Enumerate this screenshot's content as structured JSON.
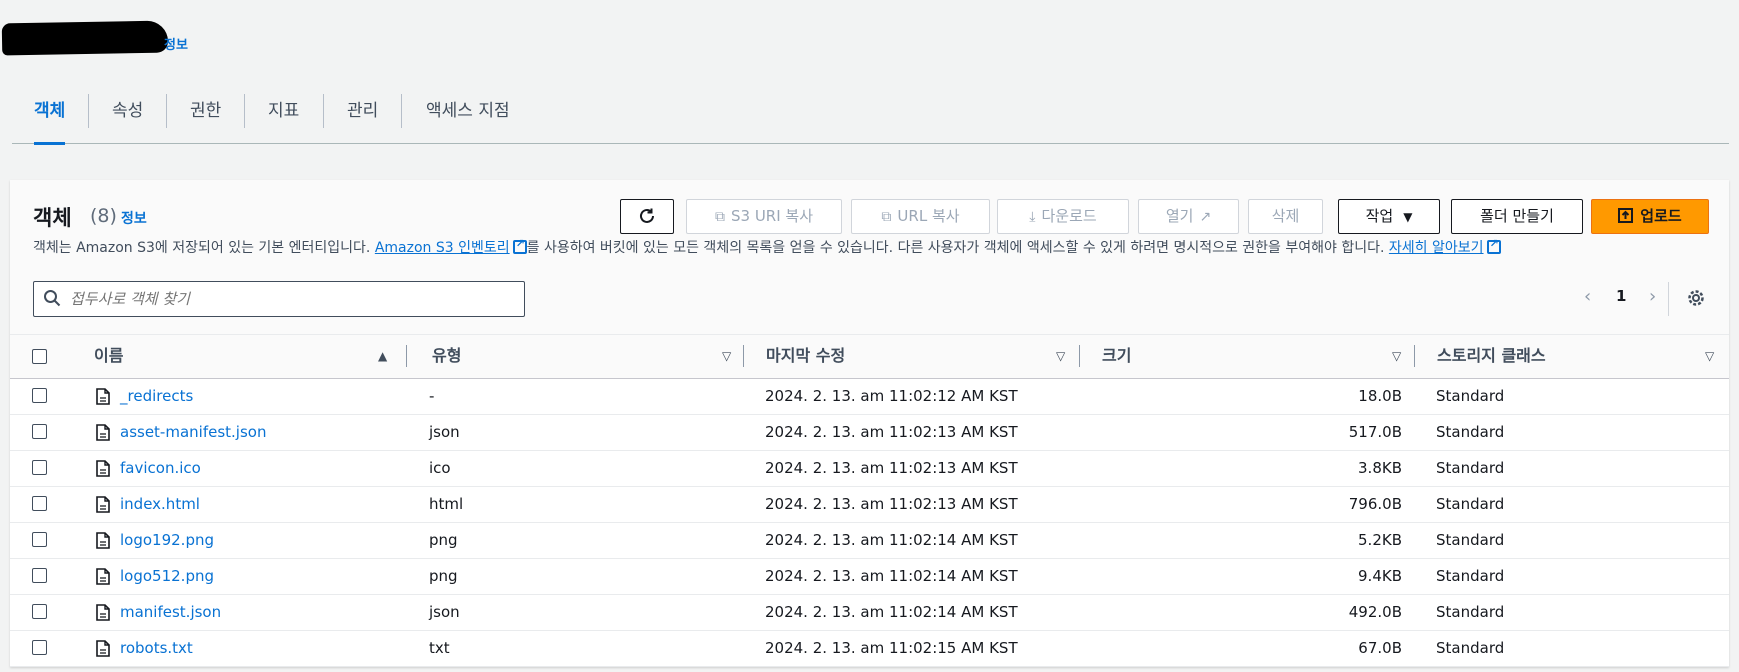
{
  "header": {
    "info_link": "정보"
  },
  "tabs": [
    {
      "label": "객체",
      "active": true
    },
    {
      "label": "속성"
    },
    {
      "label": "권한"
    },
    {
      "label": "지표"
    },
    {
      "label": "관리"
    },
    {
      "label": "액세스 지점"
    }
  ],
  "objects": {
    "title": "객체",
    "count": "(8)",
    "info_link": "정보",
    "description": {
      "part1": "객체는 Amazon S3에 저장되어 있는 기본 엔터티입니다. ",
      "link1": "Amazon S3 인벤토리",
      "part2": "를 사용하여 버킷에 있는 모든 객체의 목록을 얻을 수 있습니다. 다른 사용자가 객체에 액세스할 수 있게 하려면 명시적으로 권한을 부여해야 합니다. ",
      "link2": "자세히 알아보기"
    },
    "actions": {
      "refresh": "",
      "copy_s3_uri": "S3 URI 복사",
      "copy_url": "URL 복사",
      "download": "다운로드",
      "open": "열기",
      "delete": "삭제",
      "actions": "작업",
      "create_folder": "폴더 만들기",
      "upload": "업로드"
    },
    "search": {
      "placeholder": "접두사로 객체 찾기",
      "value": ""
    },
    "pagination": {
      "current_page": "1"
    },
    "columns": [
      "이름",
      "유형",
      "마지막 수정",
      "크기",
      "스토리지 클래스"
    ],
    "rows": [
      {
        "name": "_redirects",
        "type": "-",
        "modified": "2024. 2. 13. am 11:02:12 AM KST",
        "size": "18.0B",
        "storage": "Standard"
      },
      {
        "name": "asset-manifest.json",
        "type": "json",
        "modified": "2024. 2. 13. am 11:02:13 AM KST",
        "size": "517.0B",
        "storage": "Standard"
      },
      {
        "name": "favicon.ico",
        "type": "ico",
        "modified": "2024. 2. 13. am 11:02:13 AM KST",
        "size": "3.8KB",
        "storage": "Standard"
      },
      {
        "name": "index.html",
        "type": "html",
        "modified": "2024. 2. 13. am 11:02:13 AM KST",
        "size": "796.0B",
        "storage": "Standard"
      },
      {
        "name": "logo192.png",
        "type": "png",
        "modified": "2024. 2. 13. am 11:02:14 AM KST",
        "size": "5.2KB",
        "storage": "Standard"
      },
      {
        "name": "logo512.png",
        "type": "png",
        "modified": "2024. 2. 13. am 11:02:14 AM KST",
        "size": "9.4KB",
        "storage": "Standard"
      },
      {
        "name": "manifest.json",
        "type": "json",
        "modified": "2024. 2. 13. am 11:02:14 AM KST",
        "size": "492.0B",
        "storage": "Standard"
      },
      {
        "name": "robots.txt",
        "type": "txt",
        "modified": "2024. 2. 13. am 11:02:15 AM KST",
        "size": "67.0B",
        "storage": "Standard"
      }
    ]
  },
  "colors": {
    "link": "#0972d3",
    "primary": "#ff9900",
    "text": "#16191f"
  }
}
